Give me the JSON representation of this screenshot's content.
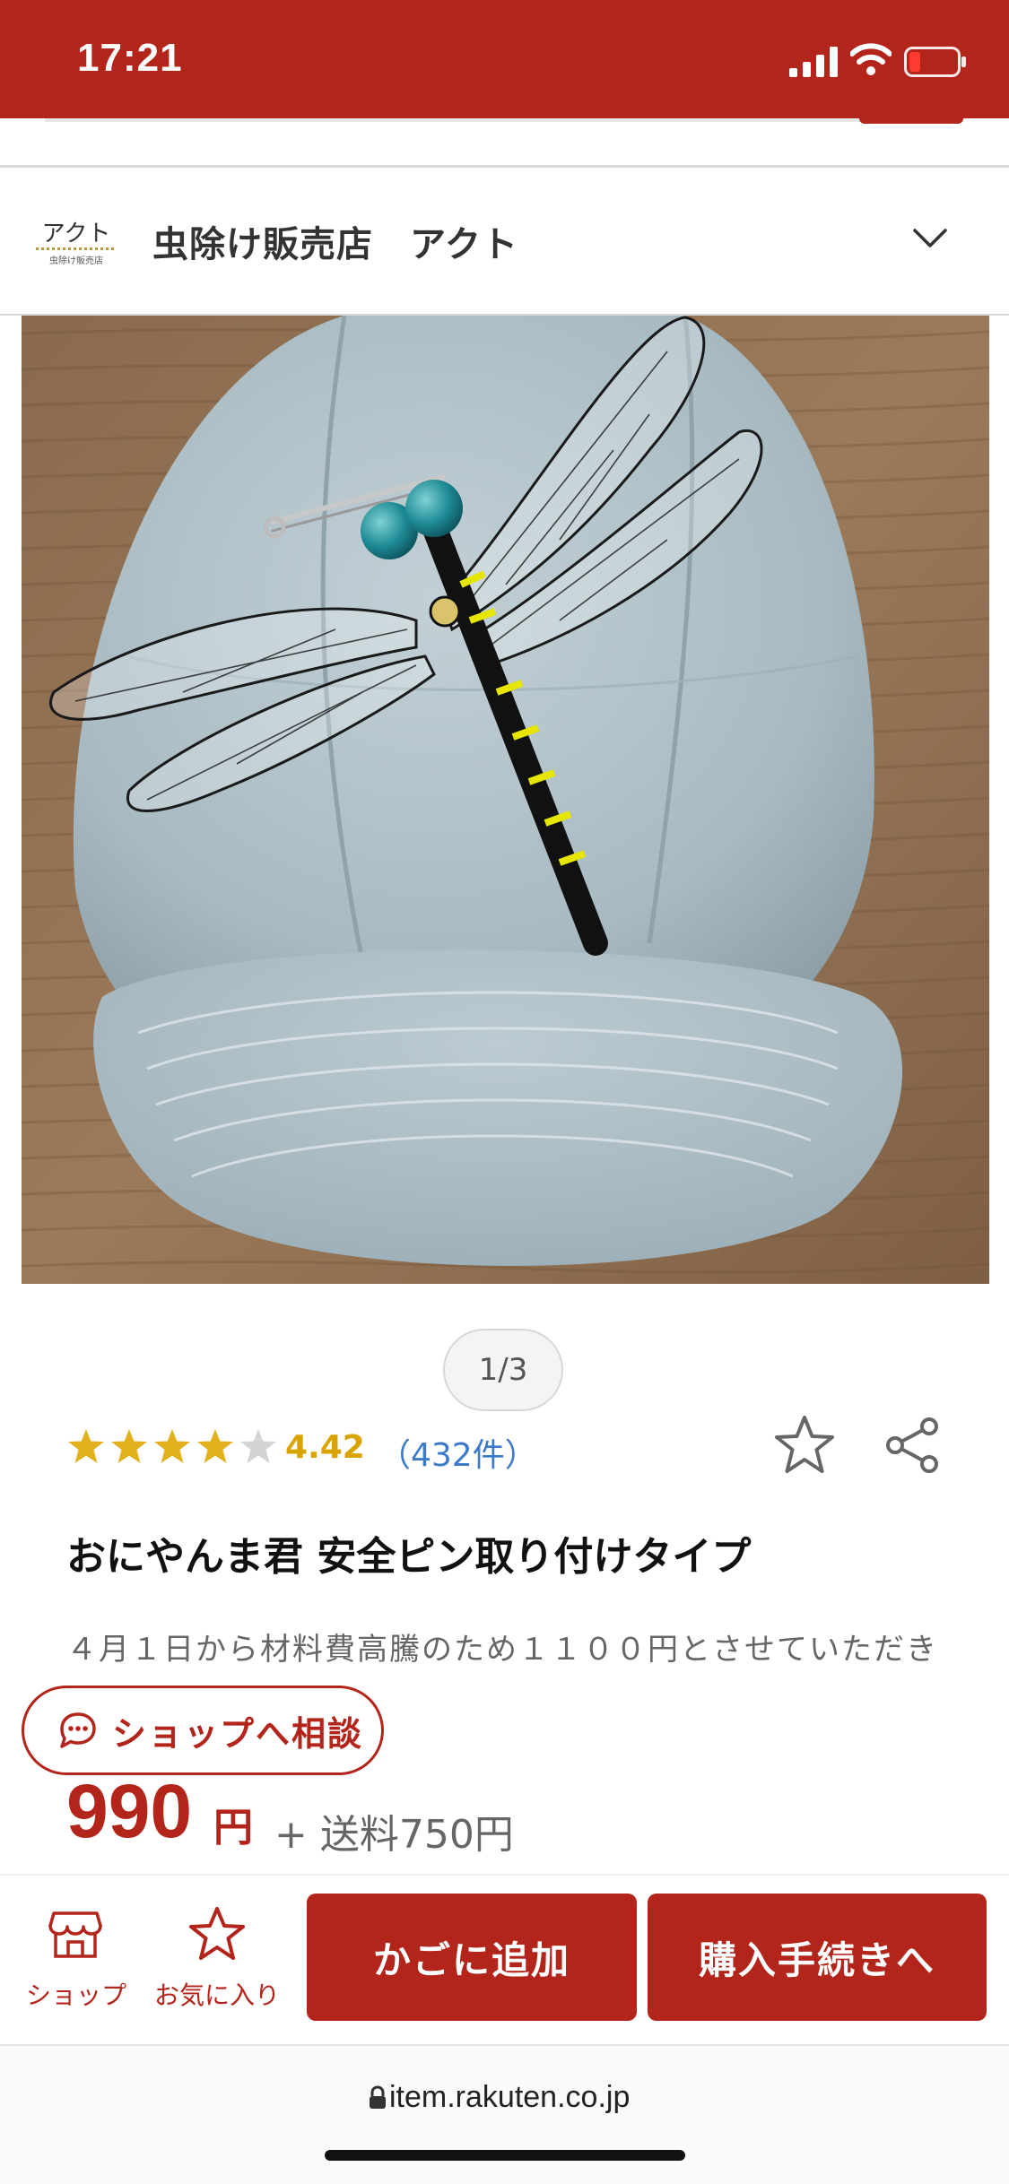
{
  "status_bar": {
    "time": "17:21",
    "background": "#b3241a"
  },
  "shop": {
    "logo_text": "アクト",
    "logo_subtext": "虫除け販売店",
    "name": "虫除け販売店　アクト"
  },
  "gallery": {
    "indicator": "1/3"
  },
  "product": {
    "rating": 4.42,
    "rating_label": "4.42",
    "stars_filled": 4,
    "reviews_label": "（432件）",
    "title": "おにやんま君 安全ピン取り付けタイプ",
    "description": "４月１日から材料費高騰のため１１００円とさせていただき",
    "price": "990",
    "price_unit": "円",
    "shipping": "+ 送料750円"
  },
  "consult_button": {
    "label": "ショップへ相談"
  },
  "bottom_bar": {
    "shop_label": "ショップ",
    "favorite_label": "お気に入り",
    "cart_label": "かごに追加",
    "buy_label": "購入手続きへ"
  },
  "browser": {
    "url": "item.rakuten.co.jp"
  },
  "colors": {
    "brand_red": "#b3241a",
    "star_gold": "#e2b21e",
    "link_blue": "#3b79c9"
  },
  "icons": [
    "signal-icon",
    "wifi-icon",
    "battery-icon",
    "chevron-down-icon",
    "star-rating-icon",
    "favorite-star-icon",
    "share-icon",
    "chat-bubble-icon",
    "shop-icon",
    "lock-icon"
  ]
}
